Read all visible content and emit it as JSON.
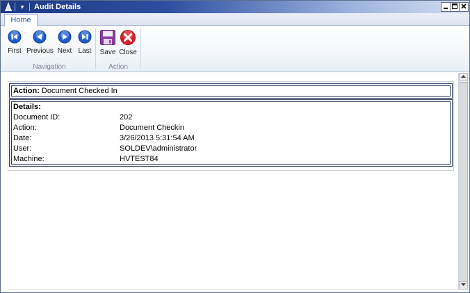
{
  "window": {
    "title": "Audit Details",
    "qat_symbol": "▾"
  },
  "tabs": [
    {
      "label": "Home"
    }
  ],
  "ribbon": {
    "groups": [
      {
        "label": "Navigation",
        "buttons": [
          {
            "label": "First",
            "icon": "first-icon"
          },
          {
            "label": "Previous",
            "icon": "previous-icon"
          },
          {
            "label": "Next",
            "icon": "next-icon"
          },
          {
            "label": "Last",
            "icon": "last-icon"
          }
        ]
      },
      {
        "label": "Action",
        "buttons": [
          {
            "label": "Save",
            "icon": "save-icon"
          },
          {
            "label": "Close",
            "icon": "close-icon"
          }
        ]
      }
    ]
  },
  "report": {
    "action_label": "Action:",
    "action_value": "Document Checked In",
    "details_title": "Details:",
    "rows": [
      {
        "key": "Document ID:",
        "value": "202"
      },
      {
        "key": "Action:",
        "value": "Document Checkin"
      },
      {
        "key": "Date:",
        "value": "3/26/2013 5:31:54 AM"
      },
      {
        "key": "User:",
        "value": "SOLDEV\\administrator"
      },
      {
        "key": "Machine:",
        "value": "HVTEST84"
      }
    ]
  },
  "colors": {
    "nav_blue": "#1f5fc8",
    "close_red": "#d81f26",
    "save_purple": "#8a3fa0"
  }
}
